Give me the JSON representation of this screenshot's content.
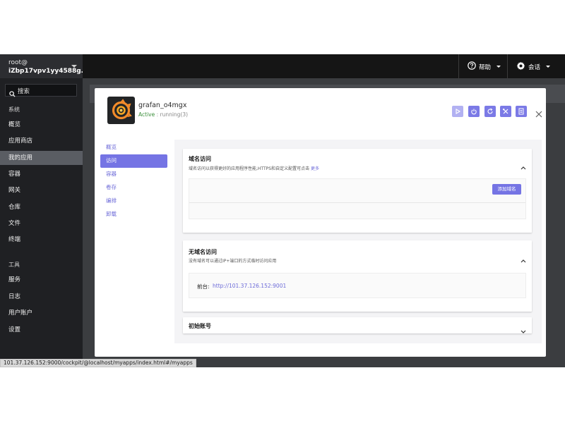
{
  "sidebar": {
    "user": "root@",
    "hostname": "iZbp17vpv1yy4588g...",
    "search_label": "搜索",
    "section_system": "系统",
    "section_tools": "工具",
    "system_items": [
      {
        "label": "概览"
      },
      {
        "label": "应用商店"
      },
      {
        "label": "我的应用"
      },
      {
        "label": "容器"
      },
      {
        "label": "网关"
      },
      {
        "label": "仓库"
      },
      {
        "label": "文件"
      },
      {
        "label": "终端"
      }
    ],
    "tool_items": [
      {
        "label": "服务"
      },
      {
        "label": "日志"
      },
      {
        "label": "用户账户"
      },
      {
        "label": "设置"
      }
    ]
  },
  "topbar": {
    "help_label": "帮助",
    "session_label": "会话"
  },
  "modal": {
    "app_name": "grafan_o4mgx",
    "status_active": "Active",
    "status_running": "running(3)",
    "tabs": [
      {
        "label": "概览"
      },
      {
        "label": "访问"
      },
      {
        "label": "容器"
      },
      {
        "label": "卷存"
      },
      {
        "label": "编排"
      },
      {
        "label": "卸载"
      }
    ],
    "domain_card": {
      "title": "域名访问",
      "desc": "域名访问以获得更好的应用程序性能,HTTPS和自定义配置可点击",
      "more": "更多",
      "add_button": "添加域名"
    },
    "nodomain_card": {
      "title": "无域名访问",
      "desc": "没有域名可以通过IP+端口的方式临时访问应用",
      "front_label": "前台:",
      "front_url": "http://101.37.126.152:9001"
    },
    "account_card": {
      "title": "初始账号"
    }
  },
  "statusbar": {
    "url": "101.37.126.152:9000/cockpit/@localhost/myapps/index.html#/myapps"
  },
  "colors": {
    "accent": "#7574e4",
    "sidebar_bg": "#1f2023",
    "topbar_bg": "#151515",
    "active_green": "#3b8f3b"
  }
}
